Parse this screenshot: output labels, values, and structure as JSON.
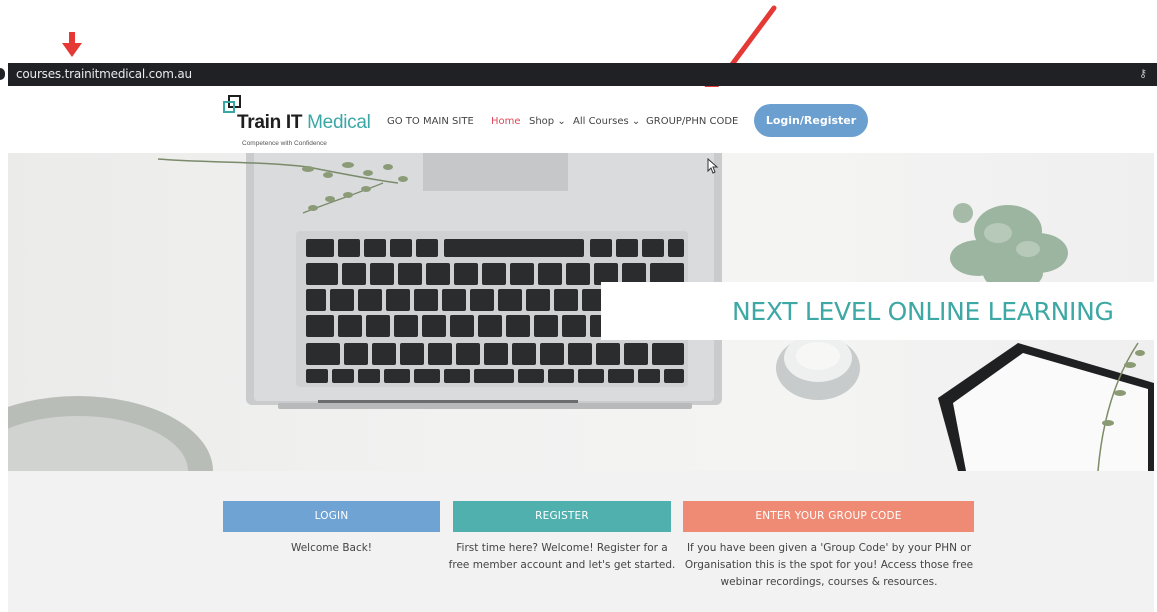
{
  "browser": {
    "url": "courses.trainitmedical.com.au",
    "key_icon": "key-icon"
  },
  "header": {
    "logo": {
      "brand_prefix": "Train IT",
      "brand_suffix": "Medical",
      "tagline": "Competence with Confidence"
    },
    "nav": {
      "main_site": "GO TO MAIN SITE",
      "home": "Home",
      "shop": "Shop ⌄",
      "all_courses": "All Courses ⌄",
      "group_code": "GROUP/PHN CODE"
    },
    "login_register": "Login/Register"
  },
  "hero": {
    "headline": "NEXT LEVEL ONLINE LEARNING"
  },
  "actions": {
    "login": {
      "label": "LOGIN",
      "description": "Welcome Back!"
    },
    "register": {
      "label": "REGISTER",
      "description": "First time here? Welcome! Register for a free member account and let's get started."
    },
    "group": {
      "label": "ENTER YOUR GROUP CODE",
      "description": "If you have been given a 'Group Code' by your PHN or Organisation this is the spot for you! Access those free webinar recordings, courses & resources."
    }
  },
  "colors": {
    "accent_teal": "#3ea8a5",
    "nav_active": "#e0475b",
    "login_blue": "#6b9fd0",
    "register_teal": "#4fb0ae",
    "group_salmon": "#ef8b74",
    "annotation_red": "#e53935"
  }
}
